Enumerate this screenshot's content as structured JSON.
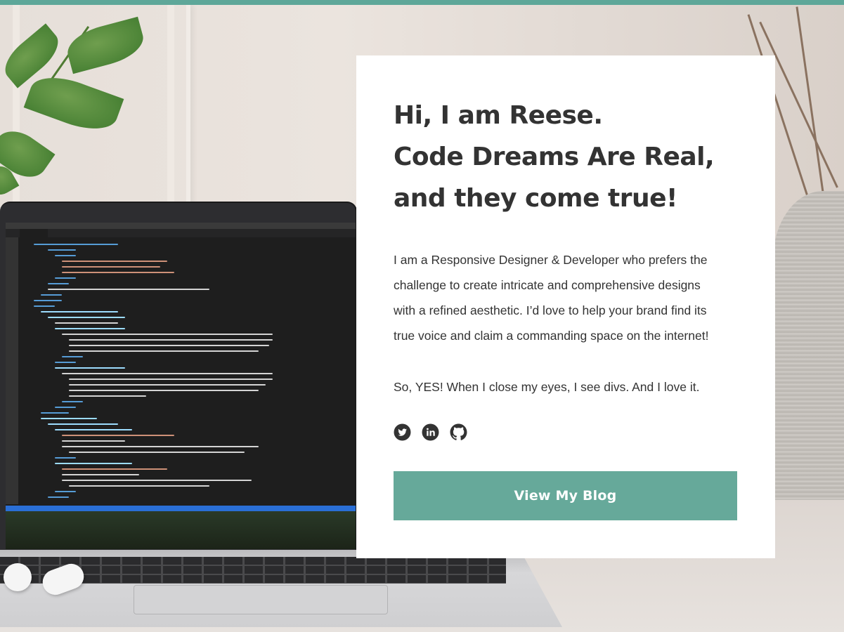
{
  "colors": {
    "accent": "#66a99a",
    "top_bar": "#5ea799",
    "heading_text": "#333333",
    "card_background": "#ffffff"
  },
  "hero": {
    "headline_lines": [
      "Hi, I am Reese.",
      "Code Dreams Are Real,",
      "and they come true!"
    ],
    "bio_lines": [
      "I am a Responsive Designer & Developer who prefers the",
      "challenge to create intricate and comprehensive designs",
      "with a refined aesthetic.  I’d love to help your brand find its",
      "true voice and claim a commanding space on the internet!"
    ],
    "tagline": "So, YES! When I close my eyes, I see divs. And I love it.",
    "social_icons": [
      "twitter-icon",
      "linkedin-icon",
      "github-icon"
    ],
    "cta_label": "View My Blog"
  }
}
